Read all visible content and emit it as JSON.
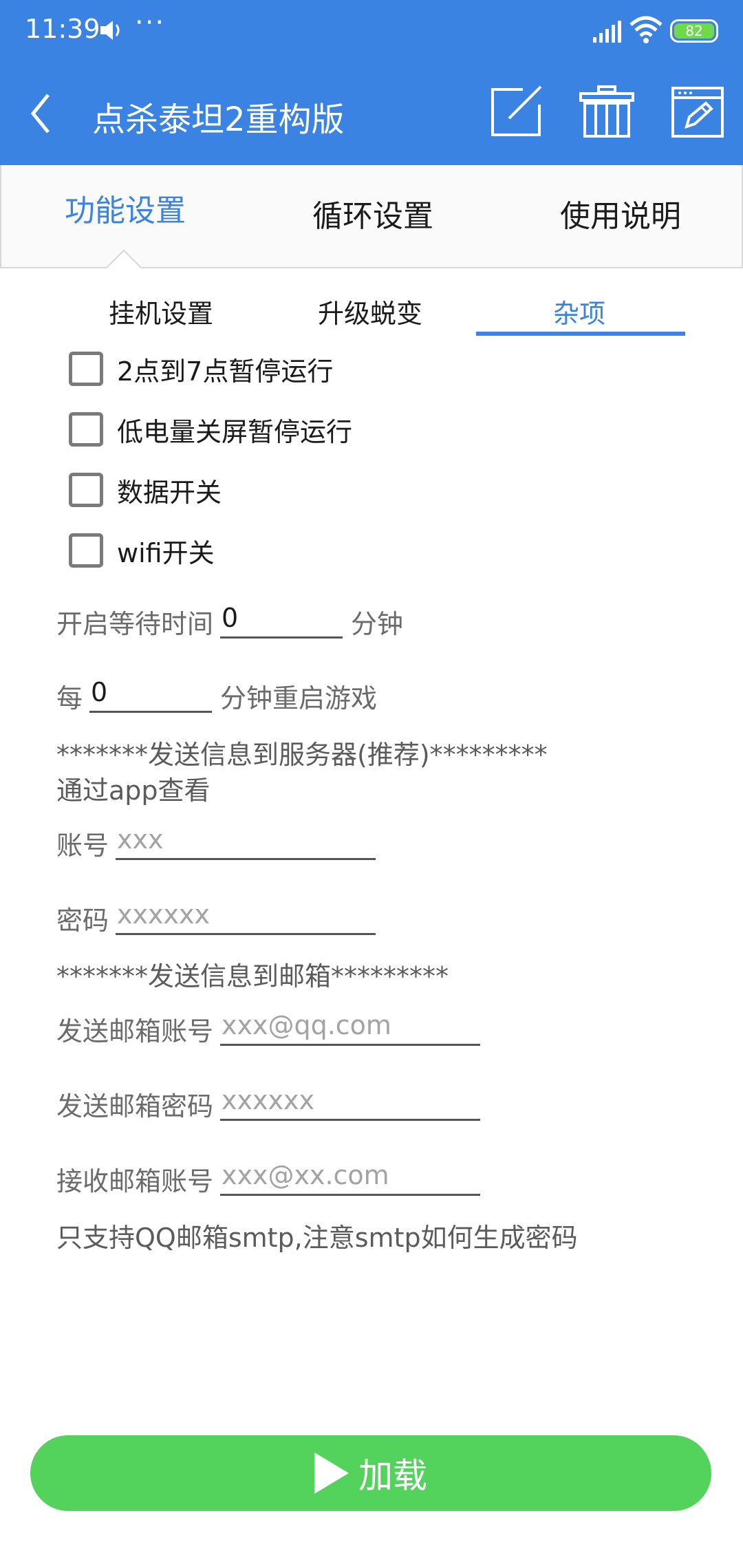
{
  "status_bar": {
    "time": "11:39",
    "dots": "···",
    "battery": "82"
  },
  "app_bar": {
    "title": "点杀泰坦2重构版"
  },
  "top_tabs": [
    {
      "label": "功能设置"
    },
    {
      "label": "循环设置"
    },
    {
      "label": "使用说明"
    }
  ],
  "sub_tabs": [
    {
      "label": "挂机设置"
    },
    {
      "label": "升级蜕变"
    },
    {
      "label": "杂项"
    }
  ],
  "checkboxes": [
    {
      "label": "2点到7点暂停运行"
    },
    {
      "label": "低电量关屏暂停运行"
    },
    {
      "label": "数据开关"
    },
    {
      "label": "wifi开关"
    }
  ],
  "wait_time": {
    "label": "开启等待时间",
    "value": "0",
    "unit": "分钟"
  },
  "restart": {
    "label": "每",
    "value": "0",
    "unit": "分钟重启游戏"
  },
  "server_section": {
    "header": "*******发送信息到服务器(推荐)*********",
    "subheader": "通过app查看",
    "account_label": "账号",
    "account_placeholder": "xxx",
    "password_label": "密码",
    "password_placeholder": "xxxxxx"
  },
  "mail_section": {
    "header": "*******发送信息到邮箱*********",
    "send_account_label": "发送邮箱账号",
    "send_account_placeholder": "xxx@qq.com",
    "send_password_label": "发送邮箱密码",
    "send_password_placeholder": "xxxxxx",
    "recv_account_label": "接收邮箱账号",
    "recv_account_placeholder": "xxx@xx.com",
    "note": "只支持QQ邮箱smtp,注意smtp如何生成密码"
  },
  "load_button": {
    "label": "加载"
  },
  "colors": {
    "primary": "#3b83e2",
    "button": "#53d35b"
  }
}
